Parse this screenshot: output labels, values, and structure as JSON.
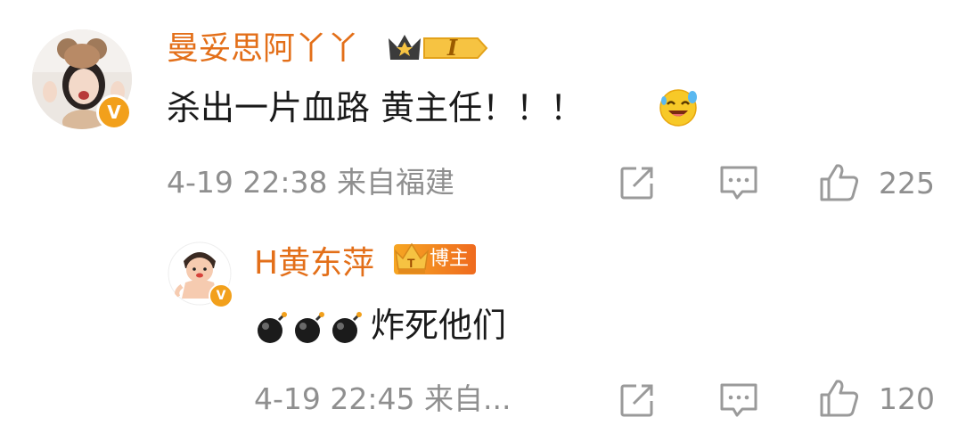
{
  "comment": {
    "username": "曼妥思阿丫丫",
    "member_level": "I",
    "verified_mark": "V",
    "text": "杀出一片血路 黄主任！！！",
    "emoji_icon": "laughing-tears-emoji",
    "timestamp": "4-19 22:38",
    "source": "来自福建",
    "like_count": "225"
  },
  "reply": {
    "username": "H黄东萍",
    "tag_label": "博主",
    "verified_mark": "V",
    "emoji_icons": [
      "bomb-emoji",
      "bomb-emoji",
      "bomb-emoji"
    ],
    "text": "炸死他们",
    "timestamp": "4-19 22:45",
    "source": "来自...",
    "like_count": "120"
  },
  "colors": {
    "username": "#e36f19",
    "meta": "#8f8f8f",
    "icon": "#9a9a9a",
    "verified": "#f2a01b"
  }
}
